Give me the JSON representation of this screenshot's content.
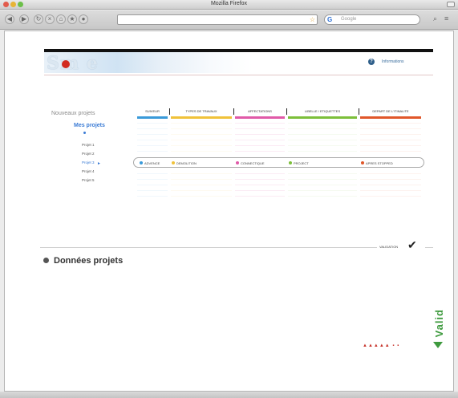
{
  "window": {
    "title": "Mozilla Firefox"
  },
  "toolbar": {
    "search_placeholder": "Google",
    "search_engine": "G"
  },
  "header": {
    "logo": "Sm e",
    "info_link": "Informations"
  },
  "nav": {
    "nouveau": "Nouveaux projets",
    "mes": "Mes projets",
    "projects": [
      "Projet 1",
      "Projet 2",
      "Projet 3",
      "Projet 4",
      "Projet 5"
    ],
    "selected_index": 2
  },
  "columns": [
    {
      "label": "SUIVEUR",
      "color": "#3a9ad9"
    },
    {
      "label": "TYPES DE TRAVAUX",
      "color": "#f0c23a"
    },
    {
      "label": "AFFECTATIONS",
      "color": "#e05aa8"
    },
    {
      "label": "LIBELLE / ETIQUETTES",
      "color": "#7cbf3a"
    },
    {
      "label": "DEPART DE L'ITINALITE",
      "color": "#e0572a"
    }
  ],
  "selected_row": [
    {
      "text": "ADVENCE",
      "color": "#3a9ad9"
    },
    {
      "text": "DEMOLITION",
      "color": "#f0c23a"
    },
    {
      "text": "CONNECTIQUE",
      "color": "#e05aa8"
    },
    {
      "text": "PROJECT",
      "color": "#7cbf3a"
    },
    {
      "text": "APRES STOPPED",
      "color": "#e0572a"
    }
  ],
  "validation": {
    "label": "VALIDATION"
  },
  "section_title": "Données projets",
  "valid_side_label": "Valid",
  "progress_marks": "▲▲▲▲▲ ▪ ▪"
}
